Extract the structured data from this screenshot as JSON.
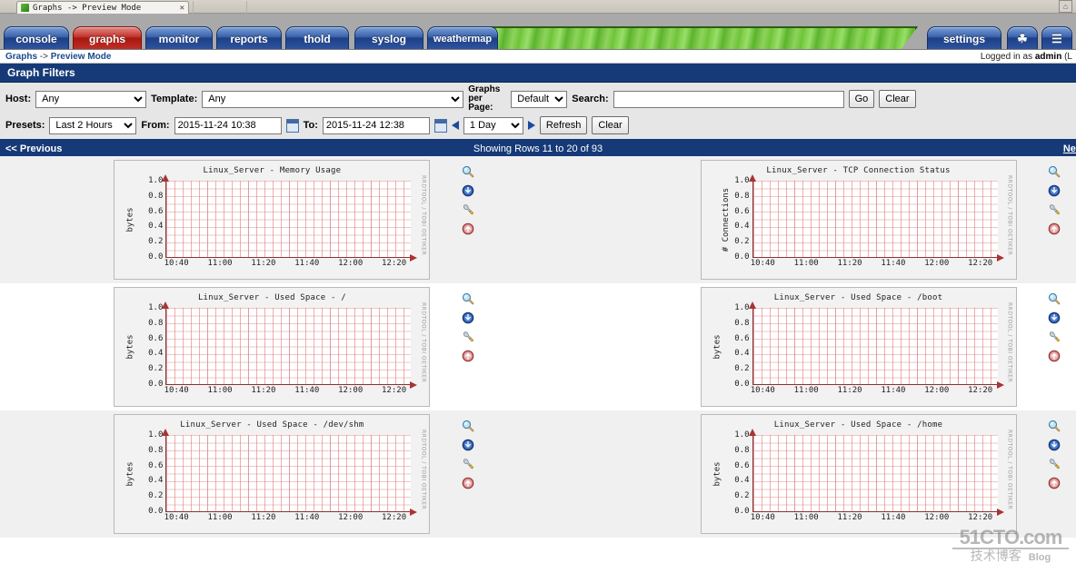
{
  "browser": {
    "tab_title": "Graphs -> Preview Mode",
    "tab_close": "✕",
    "home_icon": "⌂"
  },
  "nav": {
    "tabs": [
      {
        "label": "console",
        "active": false
      },
      {
        "label": "graphs",
        "active": true
      },
      {
        "label": "monitor",
        "active": false
      },
      {
        "label": "reports",
        "active": false
      },
      {
        "label": "thold",
        "active": false
      },
      {
        "label": "syslog",
        "active": false
      },
      {
        "label": "weathermap",
        "active": false
      },
      {
        "label": "settings",
        "active": false
      }
    ],
    "icon_tabs": [
      {
        "name": "tree-icon",
        "glyph": "☘"
      },
      {
        "name": "menu-icon",
        "glyph": "☰"
      }
    ]
  },
  "statusbar": {
    "breadcrumb_root": "Graphs",
    "breadcrumb_sep": " -> ",
    "breadcrumb_leaf": "Preview Mode",
    "logged_in_prefix": "Logged in as ",
    "logged_in_user": "admin",
    "logged_in_suffix": " (L"
  },
  "filters": {
    "title": "Graph Filters",
    "host_label": "Host:",
    "host_value": "Any",
    "template_label": "Template:",
    "template_value": "Any",
    "graphs_per_page_label": "Graphs per Page:",
    "graphs_per_page_value": "Default",
    "search_label": "Search:",
    "search_value": "",
    "search_placeholder": "",
    "go_label": "Go",
    "clear_label": "Clear",
    "presets_label": "Presets:",
    "presets_value": "Last 2 Hours",
    "from_label": "From:",
    "from_value": "2015-11-24 10:38",
    "to_label": "To:",
    "to_value": "2015-11-24 12:38",
    "span_value": "1 Day",
    "refresh_label": "Refresh",
    "clear2_label": "Clear"
  },
  "pagination": {
    "previous": "<< Previous",
    "showing": "Showing Rows 11 to 20 of 93",
    "next": "Nex"
  },
  "graph_common": {
    "ytick_labels": [
      "1.0",
      "0.8",
      "0.6",
      "0.4",
      "0.2",
      "0.0"
    ],
    "xtick_labels": [
      "10:40",
      "11:00",
      "11:20",
      "11:40",
      "12:00",
      "12:20"
    ],
    "rrd_watermark": "RRDTOOL / TOBI OETIKER",
    "action_icons": [
      {
        "name": "zoom-graph-icon",
        "title": "Zoom Graph"
      },
      {
        "name": "csv-export-icon",
        "title": "Graph Source/Properties"
      },
      {
        "name": "graph-properties-icon",
        "title": "Graph Debug"
      },
      {
        "name": "page-top-icon",
        "title": "Graph Details"
      }
    ]
  },
  "chart_data": [
    {
      "type": "line",
      "title": "Linux_Server - Memory Usage",
      "ylabel": "bytes",
      "xlabel": "",
      "ylim": [
        0.0,
        1.0
      ],
      "yticks": [
        0.0,
        0.2,
        0.4,
        0.6,
        0.8,
        1.0
      ],
      "x": [
        "10:40",
        "11:00",
        "11:20",
        "11:40",
        "12:00",
        "12:20"
      ],
      "series": [],
      "grid": true,
      "legend": "none",
      "note": "no data plotted"
    },
    {
      "type": "line",
      "title": "Linux_Server - TCP Connection Status",
      "ylabel": "# Connections",
      "xlabel": "",
      "ylim": [
        0.0,
        1.0
      ],
      "yticks": [
        0.0,
        0.2,
        0.4,
        0.6,
        0.8,
        1.0
      ],
      "x": [
        "10:40",
        "11:00",
        "11:20",
        "11:40",
        "12:00",
        "12:20"
      ],
      "series": [],
      "grid": true,
      "legend": "none",
      "note": "no data plotted"
    },
    {
      "type": "line",
      "title": "Linux_Server - Used Space - /",
      "ylabel": "bytes",
      "xlabel": "",
      "ylim": [
        0.0,
        1.0
      ],
      "yticks": [
        0.0,
        0.2,
        0.4,
        0.6,
        0.8,
        1.0
      ],
      "x": [
        "10:40",
        "11:00",
        "11:20",
        "11:40",
        "12:00",
        "12:20"
      ],
      "series": [],
      "grid": true,
      "legend": "none",
      "note": "no data plotted"
    },
    {
      "type": "line",
      "title": "Linux_Server - Used Space - /boot",
      "ylabel": "bytes",
      "xlabel": "",
      "ylim": [
        0.0,
        1.0
      ],
      "yticks": [
        0.0,
        0.2,
        0.4,
        0.6,
        0.8,
        1.0
      ],
      "x": [
        "10:40",
        "11:00",
        "11:20",
        "11:40",
        "12:00",
        "12:20"
      ],
      "series": [],
      "grid": true,
      "legend": "none",
      "note": "no data plotted"
    },
    {
      "type": "line",
      "title": "Linux_Server - Used Space - /dev/shm",
      "ylabel": "bytes",
      "xlabel": "",
      "ylim": [
        0.0,
        1.0
      ],
      "yticks": [
        0.0,
        0.2,
        0.4,
        0.6,
        0.8,
        1.0
      ],
      "x": [
        "10:40",
        "11:00",
        "11:20",
        "11:40",
        "12:00",
        "12:20"
      ],
      "series": [],
      "grid": true,
      "legend": "none",
      "note": "no data plotted"
    },
    {
      "type": "line",
      "title": "Linux_Server - Used Space - /home",
      "ylabel": "bytes",
      "xlabel": "",
      "ylim": [
        0.0,
        1.0
      ],
      "yticks": [
        0.0,
        0.2,
        0.4,
        0.6,
        0.8,
        1.0
      ],
      "x": [
        "10:40",
        "11:00",
        "11:20",
        "11:40",
        "12:00",
        "12:20"
      ],
      "series": [],
      "grid": true,
      "legend": "none",
      "note": "no data plotted"
    }
  ],
  "watermark": {
    "line1": "51CTO.com",
    "line2": "技术博客",
    "blog": "Blog"
  },
  "colors": {
    "nav_active": "#b5241c",
    "nav_tab": "#2f56a0",
    "panel_header": "#163a77",
    "filter_bg": "#e6e6e6",
    "grid_red": "#dc6e6e"
  }
}
